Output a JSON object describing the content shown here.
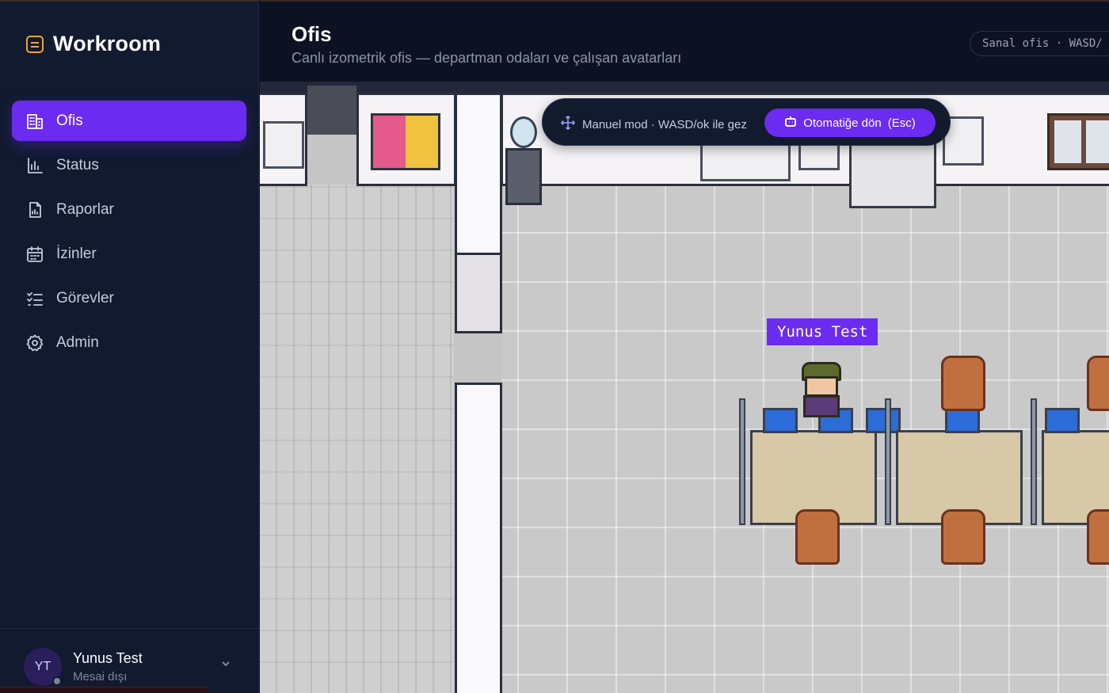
{
  "app": {
    "name": "Workroom",
    "logo_icon": "notebook-icon",
    "accent": "#6b2bf0",
    "logo_color": "#f2a23a"
  },
  "sidebar": {
    "items": [
      {
        "label": "Ofis",
        "icon": "building-icon",
        "active": true
      },
      {
        "label": "Status",
        "icon": "bar-chart-icon",
        "active": false
      },
      {
        "label": "Raporlar",
        "icon": "report-icon",
        "active": false
      },
      {
        "label": "İzinler",
        "icon": "calendar-icon",
        "active": false
      },
      {
        "label": "Görevler",
        "icon": "task-list-icon",
        "active": false
      },
      {
        "label": "Admin",
        "icon": "gear-icon",
        "active": false
      }
    ]
  },
  "user": {
    "initials": "YT",
    "name": "Yunus Test",
    "status": "Mesai dışı",
    "status_color": "#7b8499"
  },
  "header": {
    "title": "Ofis",
    "subtitle": "Canlı izometrik ofis — departman odaları ve çalışan avatarları",
    "chip": "Sanal ofis · WASD/"
  },
  "office": {
    "avatar_name": "Yunus Test",
    "mode_bar": {
      "label": "Manuel mod · WASD/ok ile gez",
      "button": "Otomatiğe dön",
      "shortcut": "(Esc)"
    }
  }
}
